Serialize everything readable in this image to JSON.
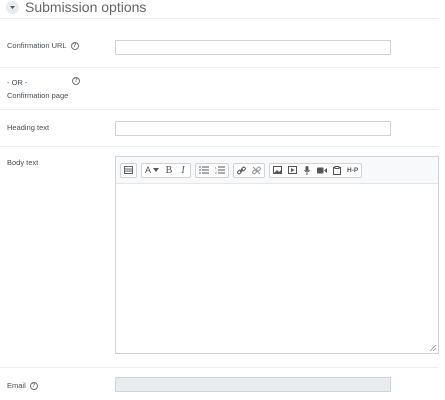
{
  "section": {
    "title": "Submission options"
  },
  "fields": {
    "confirmation_url": {
      "label": "Confirmation URL",
      "value": ""
    },
    "or_label": "- OR -",
    "confirmation_page": {
      "label": "Confirmation page"
    },
    "heading_text": {
      "label": "Heading text",
      "value": ""
    },
    "body_text": {
      "label": "Body text"
    },
    "email": {
      "label": "Email",
      "value": ""
    }
  },
  "help_glyph": "?",
  "toolbar": {
    "font_size_label": "A",
    "bold_label": "B",
    "italic_label": "I",
    "h5p_label": "H-P"
  }
}
